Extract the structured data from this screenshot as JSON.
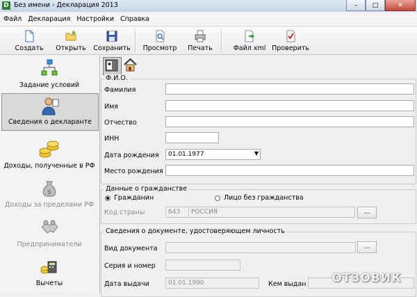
{
  "window": {
    "app_icon_letter": "D",
    "title": "Без имени - Декларация 2013",
    "buttons": {
      "minimize": "–",
      "maximize": "□",
      "close": "✕"
    }
  },
  "menu": [
    "Файл",
    "Декларация",
    "Настройки",
    "Справка"
  ],
  "toolbar": {
    "create": "Создать",
    "open": "Открыть",
    "save": "Сохранить",
    "preview": "Просмотр",
    "print": "Печать",
    "xml": "Файл xml",
    "check": "Проверить"
  },
  "sidebar": {
    "items": [
      {
        "label": "Задание условий",
        "state": "normal"
      },
      {
        "label": "Сведения о декларанте",
        "state": "active"
      },
      {
        "label": "Доходы, полученные в РФ",
        "state": "normal"
      },
      {
        "label": "Доходы за пределами РФ",
        "state": "disabled"
      },
      {
        "label": "Предприниматели",
        "state": "disabled"
      },
      {
        "label": "Вычеты",
        "state": "normal"
      }
    ]
  },
  "fio": {
    "group_title": "Ф.И.О.",
    "surname_label": "Фамилия",
    "surname_value": "",
    "name_label": "Имя",
    "name_value": "",
    "patronymic_label": "Отчество",
    "patronymic_value": "",
    "inn_label": "ИНН",
    "inn_value": "",
    "birthdate_label": "Дата рождения",
    "birthdate_value": "01.01.1977",
    "birthplace_label": "Место рождения",
    "birthplace_value": ""
  },
  "citizenship": {
    "group_title": "Данные о гражданстве",
    "option_citizen": "Гражданин",
    "option_stateless": "Лицо без гражданства",
    "selected": "citizen",
    "country_code_label": "Код страны",
    "country_code": "643",
    "country_name": "РОССИЯ",
    "dots": "..."
  },
  "id_document": {
    "group_title": "Сведения о документе, удостоверяющем личность",
    "doc_type_label": "Вид документа",
    "doc_type_value": "",
    "series_label": "Серия и номер",
    "series_value": "",
    "issue_date_label": "Дата выдачи",
    "issue_date_value": "01.01.1990",
    "issued_by_label": "Кем выдан",
    "dots": "..."
  },
  "watermark": "ОТЗОВИК"
}
